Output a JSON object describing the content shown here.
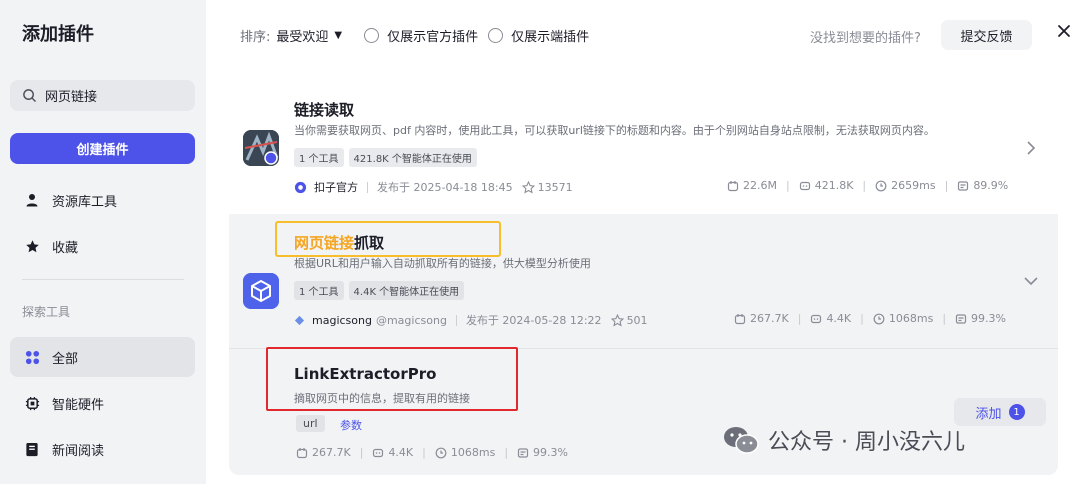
{
  "sidebar": {
    "title": "添加插件",
    "search_value": "网页链接",
    "create_label": "创建插件",
    "items": [
      {
        "label": "资源库工具",
        "icon": "user-icon"
      },
      {
        "label": "收藏",
        "icon": "star-icon"
      }
    ],
    "section_label": "探索工具",
    "explore_items": [
      {
        "label": "全部",
        "icon": "grid-icon",
        "active": true
      },
      {
        "label": "智能硬件",
        "icon": "chip-icon"
      },
      {
        "label": "新闻阅读",
        "icon": "book-icon"
      }
    ]
  },
  "topbar": {
    "sort_label": "排序:",
    "sort_value": "最受欢迎",
    "filter_official": "仅展示官方插件",
    "filter_edge": "仅展示端插件",
    "feedback_question": "没找到想要的插件?",
    "feedback_button": "提交反馈"
  },
  "plugins": [
    {
      "title": "链接读取",
      "description": "当你需要获取网页、pdf 内容时，使用此工具，可以获取url链接下的标题和内容。由于个别网站自身站点限制，无法获取网页内容。",
      "tags": [
        "1 个工具",
        "421.8K 个智能体正在使用"
      ],
      "author": "扣子官方",
      "published": "发布于 2025-04-18 18:45",
      "favorites": "13571",
      "stats": [
        "22.6M",
        "421.8K",
        "2659ms",
        "89.9%"
      ]
    },
    {
      "title_highlight": "网页链接",
      "title_rest": "抓取",
      "description": "根据URL和用户输入自动抓取所有的链接，供大模型分析使用",
      "tags": [
        "1 个工具",
        "4.4K 个智能体正在使用"
      ],
      "author": "magicsong",
      "handle": "@magicsong",
      "published": "发布于 2024-05-28 12:22",
      "favorites": "501",
      "stats": [
        "267.7K",
        "4.4K",
        "1068ms",
        "99.3%"
      ]
    },
    {
      "title": "LinkExtractorPro",
      "description": "摘取网页中的信息，提取有用的链接",
      "tag": "url",
      "param_label": "参数",
      "add_label": "添加",
      "add_badge": "1",
      "stats": [
        "267.7K",
        "4.4K",
        "1068ms",
        "99.3%"
      ]
    }
  ],
  "watermark": "公众号 · 周小没六儿",
  "colors": {
    "accent": "#4d53e8",
    "highlight": "#f5a623",
    "box_orange": "#f7bd2b",
    "box_red": "#e3282d"
  }
}
